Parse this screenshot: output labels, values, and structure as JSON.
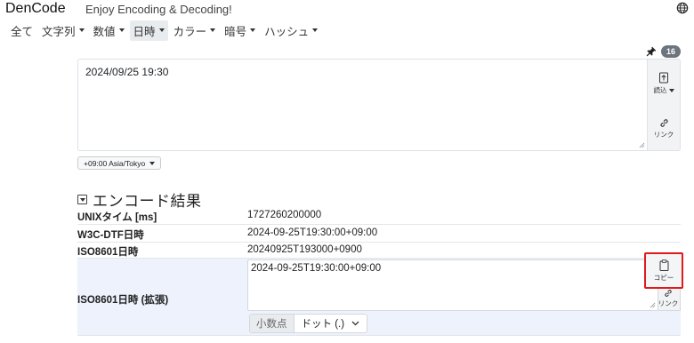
{
  "header": {
    "brand": "DenCode",
    "tagline": "Enjoy Encoding & Decoding!"
  },
  "menu": [
    {
      "label": "全て",
      "has_caret": false,
      "active": false
    },
    {
      "label": "文字列",
      "has_caret": true,
      "active": false
    },
    {
      "label": "数値",
      "has_caret": true,
      "active": false
    },
    {
      "label": "日時",
      "has_caret": true,
      "active": true
    },
    {
      "label": "カラー",
      "has_caret": true,
      "active": false
    },
    {
      "label": "暗号",
      "has_caret": true,
      "active": false
    },
    {
      "label": "ハッシュ",
      "has_caret": true,
      "active": false
    }
  ],
  "toolbar": {
    "badge_count": "16"
  },
  "input": {
    "value": "2024/09/25 19:30",
    "load_label": "読込",
    "link_label": "リンク"
  },
  "timezone": {
    "selected": "+09:00 Asia/Tokyo"
  },
  "section": {
    "title": "エンコード結果"
  },
  "results": {
    "unix": {
      "label": "UNIXタイム [ms]",
      "value": "1727260200000"
    },
    "w3c": {
      "label": "W3C-DTF日時",
      "value": "2024-09-25T19:30:00+09:00"
    },
    "iso": {
      "label": "ISO8601日時",
      "value": "20240925T193000+0900"
    },
    "iso_ext": {
      "label": "ISO8601日時 (拡張)",
      "value": "2024-09-25T19:30:00+09:00",
      "copy_label": "コピー",
      "link_label": "リンク",
      "decimal_label": "小数点",
      "decimal_value": "ドット (.)"
    }
  },
  "colors": {
    "highlight_row": "#edf2fd",
    "focus_outline": "#e0191b",
    "badge": "#6c757d"
  }
}
